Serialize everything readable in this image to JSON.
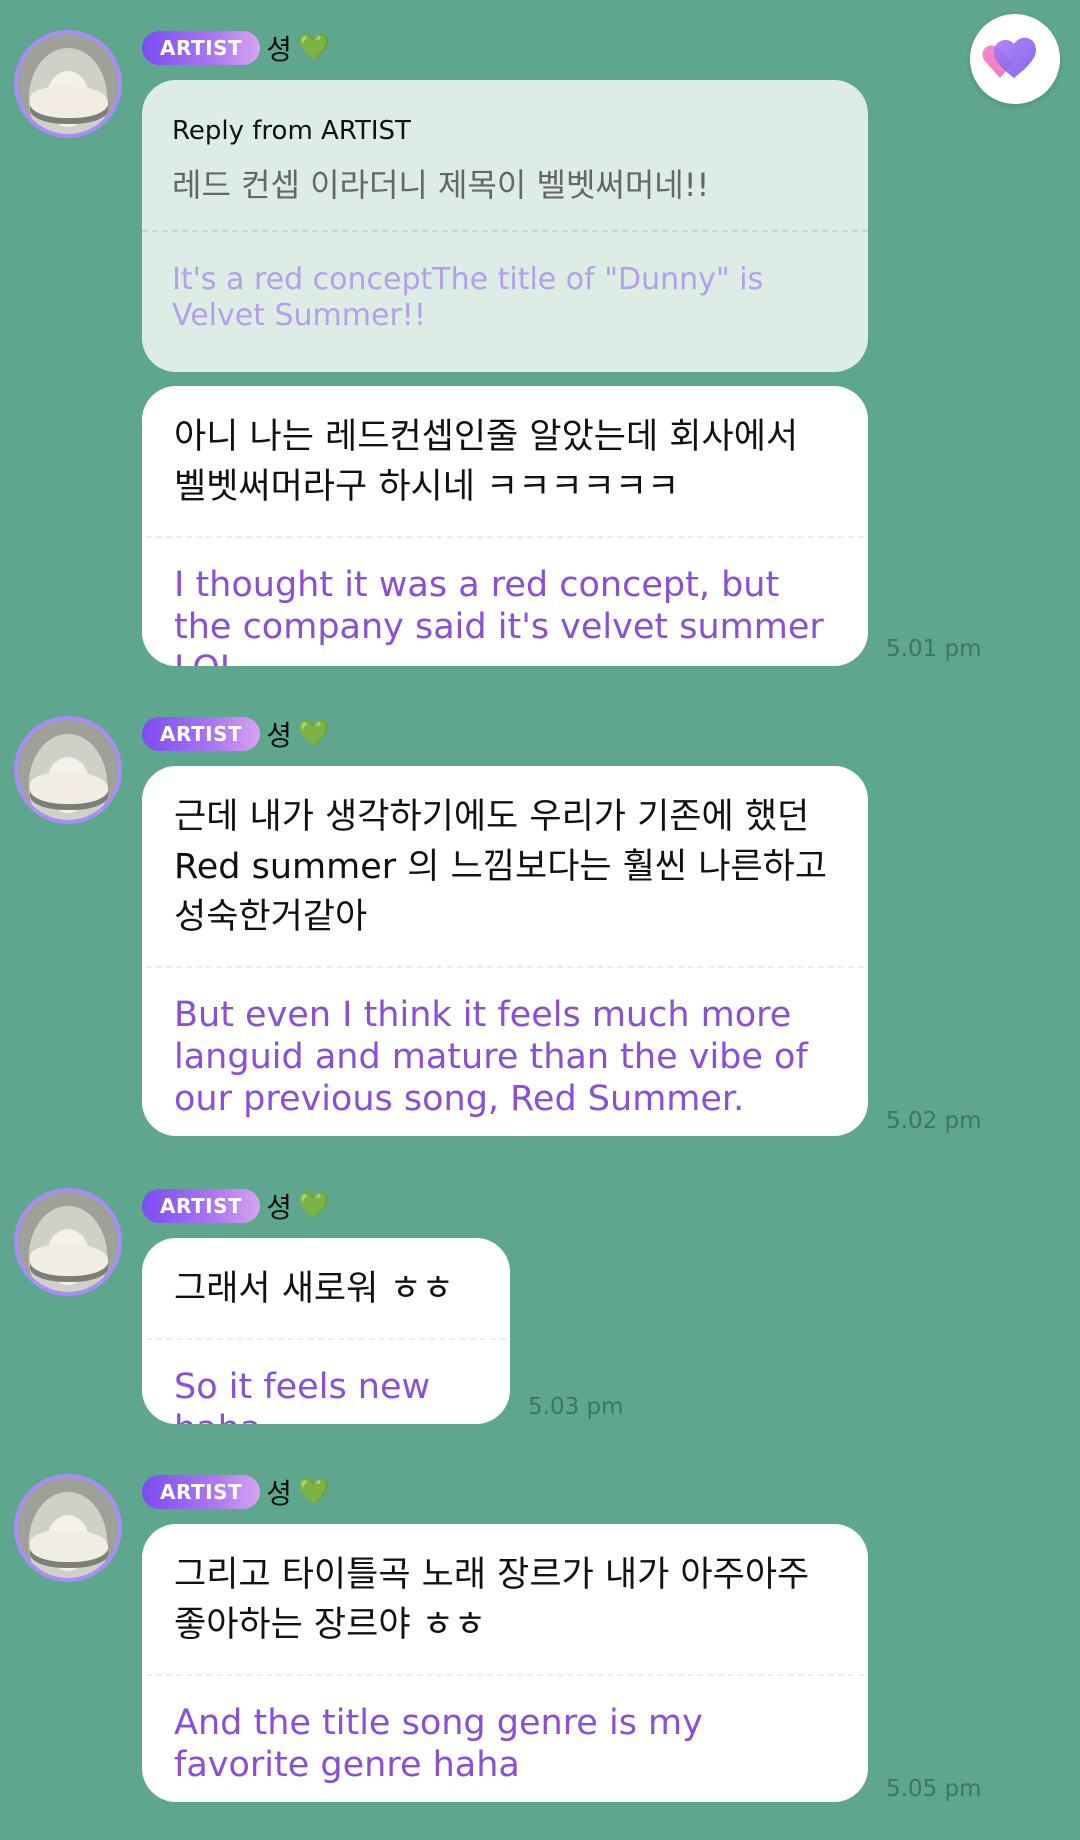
{
  "badge": "ARTIST",
  "messages": [
    {
      "sender": "셩",
      "heart": "💚",
      "reply": {
        "label": "Reply from ARTIST",
        "original": "레드 컨셉 이라더니 제목이 벨벳써머네!!",
        "translation": "It's a red conceptThe title of \"Dunny\" is Velvet Summer!!"
      },
      "text": "아니 나는 레드컨셉인줄 알았는데 회사에서 벨벳써머라구 하시네 ㅋㅋㅋㅋㅋㅋ",
      "translation": "I thought it was a red concept, but the company said it's velvet summer LOL",
      "time": "5.01 pm"
    },
    {
      "sender": "셩",
      "heart": "💚",
      "text": "근데 내가 생각하기에도 우리가 기존에 했던 Red summer 의 느낌보다는 훨씬 나른하고 성숙한거같아",
      "translation": "But even I think it feels much more languid and mature than the vibe of our previous song, Red Summer.",
      "time": "5.02 pm"
    },
    {
      "sender": "셩",
      "heart": "💚",
      "text": "그래서 새로워 ㅎㅎ",
      "translation": "So it feels new haha",
      "time": "5.03 pm"
    },
    {
      "sender": "셩",
      "heart": "💚",
      "text": "그리고 타이틀곡 노래 장르가 내가 아주아주 좋아하는 장르야 ㅎㅎ",
      "translation": "And the title song genre is my favorite genre haha",
      "time": "5.05 pm"
    }
  ],
  "colors": {
    "background": "#5fa68f",
    "translation": "#8b4fd6",
    "badge_start": "#7b4cf2",
    "badge_end": "#d7a4ef"
  },
  "icons": {
    "fab": "heart-icon"
  }
}
